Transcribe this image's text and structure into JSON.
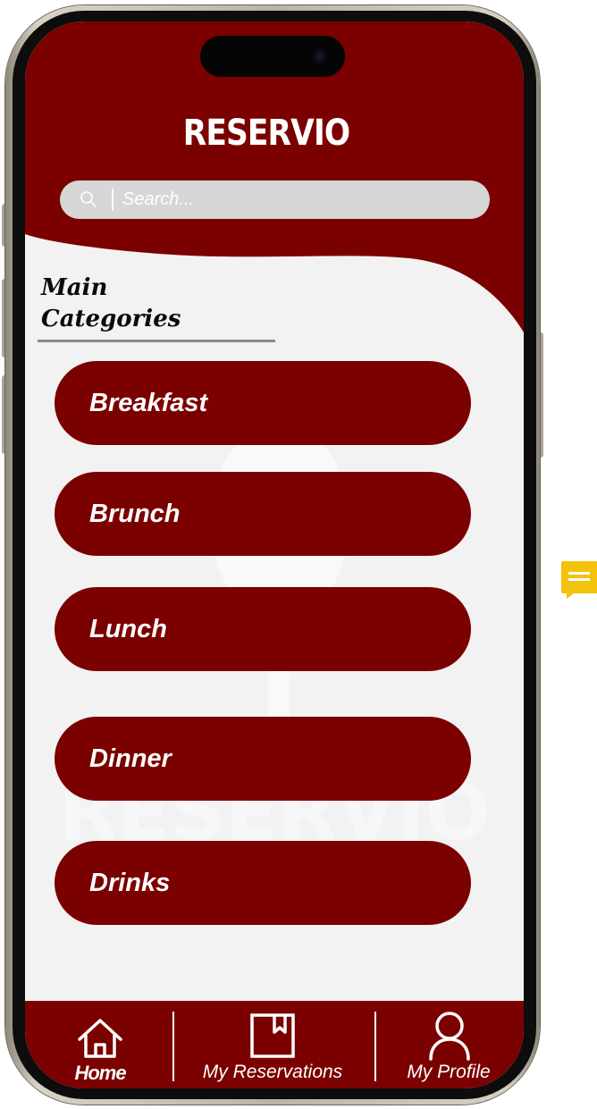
{
  "app": {
    "title": "RESERVIO",
    "watermark_text": "RESERVIO"
  },
  "search": {
    "placeholder": "Search...",
    "value": ""
  },
  "section": {
    "title_line1": "Main",
    "title_line2": "Categories"
  },
  "categories": [
    {
      "label": "Breakfast"
    },
    {
      "label": "Brunch"
    },
    {
      "label": "Lunch"
    },
    {
      "label": "Dinner"
    },
    {
      "label": "Drinks"
    }
  ],
  "bottom_nav": {
    "items": [
      {
        "label": "Home",
        "icon": "home-icon",
        "active": true
      },
      {
        "label": "My Reservations",
        "icon": "bookmark-icon",
        "active": false
      },
      {
        "label": "My Profile",
        "icon": "user-icon",
        "active": false
      }
    ]
  },
  "colors": {
    "brand": "#7b0000",
    "background": "#f3f2f3",
    "search_bar": "#d6d6d6",
    "comment_badge": "#f4c20d"
  },
  "icons": {
    "search": "search-icon",
    "comment": "comment-icon"
  }
}
